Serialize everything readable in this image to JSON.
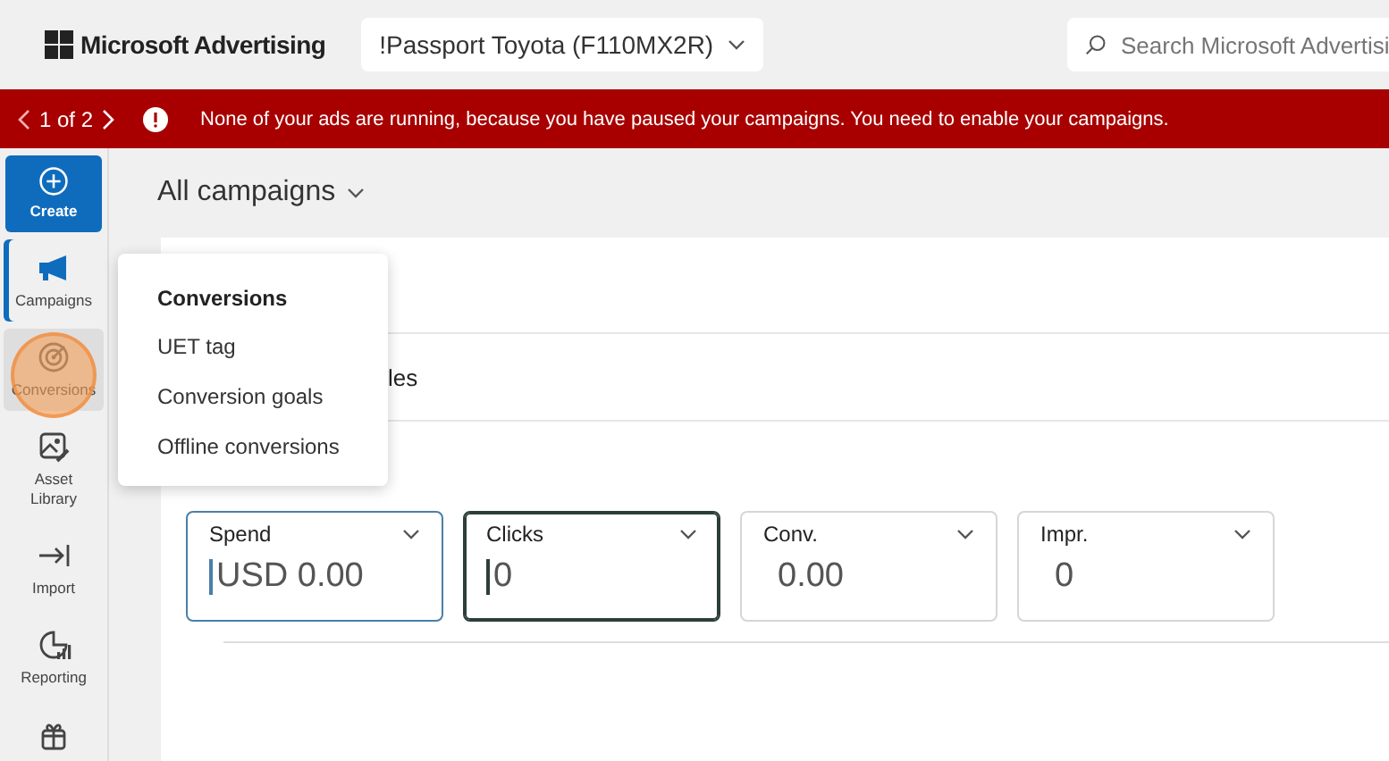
{
  "top_bar": {
    "brand": "Microsoft Advertising",
    "account": "!Passport Toyota (F110MX2R)",
    "search": {
      "placeholder": "Search Microsoft Advertisi"
    }
  },
  "banner": {
    "pager": "1 of 2",
    "message": "None of your ads are running, because you have paused your campaigns. You need to enable your campaigns."
  },
  "rail": [
    {
      "kind": "create",
      "label": "Create",
      "selected": false,
      "expanded": false
    },
    {
      "kind": "campaigns",
      "label": "Campaigns",
      "selected": true,
      "expanded": false
    },
    {
      "kind": "conversions",
      "label": "Conversions",
      "selected": false,
      "expanded": true
    },
    {
      "kind": "assets",
      "label": "Asset\nLibrary",
      "selected": false,
      "expanded": false
    },
    {
      "kind": "import",
      "label": "Import",
      "selected": false,
      "expanded": false
    },
    {
      "kind": "reporting",
      "label": "Reporting",
      "selected": false,
      "expanded": false
    },
    {
      "kind": "gift",
      "selected": false,
      "expanded": false
    }
  ],
  "header": {
    "title": "All campaigns"
  },
  "tab_fragment": "les",
  "menu": {
    "title": "Conversions",
    "items": [
      "UET tag",
      "Conversion goals",
      "Offline conversions"
    ]
  },
  "metrics": [
    {
      "label": "Spend",
      "value": "USD 0.00",
      "selected": true,
      "focused": false
    },
    {
      "label": "Clicks",
      "value": "0",
      "selected": false,
      "focused": true
    },
    {
      "label": "Conv.",
      "value": "0.00",
      "selected": false,
      "focused": false
    },
    {
      "label": "Impr.",
      "value": "0",
      "selected": false,
      "focused": false
    }
  ]
}
